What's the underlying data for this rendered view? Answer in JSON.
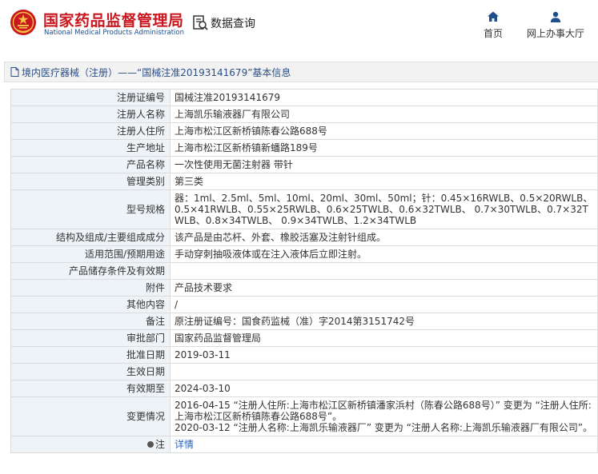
{
  "header": {
    "brand_cn": "国家药品监督管理局",
    "brand_en": "National Medical Products Administration",
    "query_label": "数据查询",
    "nav_home": "首页",
    "nav_office": "网上办事大厅",
    "colors": {
      "brand_red": "#c8171e",
      "nav_blue": "#1f4e8c"
    }
  },
  "breadcrumb": "境内医疗器械（注册）——“国械注准20193141679”基本信息",
  "rows": [
    {
      "label": "注册证编号",
      "value": "国械注准20193141679"
    },
    {
      "label": "注册人名称",
      "value": "上海凯乐输液器厂有限公司"
    },
    {
      "label": "注册人住所",
      "value": "上海市松江区新桥镇陈春公路688号"
    },
    {
      "label": "生产地址",
      "value": "上海市松江区新桥镇新蟠路189号"
    },
    {
      "label": "产品名称",
      "value": "一次性使用无菌注射器 带针"
    },
    {
      "label": "管理类别",
      "value": "第三类"
    },
    {
      "label": "型号规格",
      "value": "器：1ml、2.5ml、5ml、10ml、20ml、30ml、50ml；针：0.45×16RWLB、0.5×20RWLB、0.5×41RWLB、0.55×25RWLB、0.6×25TWLB、0.6×32TWLB、 0.7×30TWLB、0.7×32TWLB、0.8×34TWLB、 0.9×34TWLB、1.2×34TWLB"
    },
    {
      "label": "结构及组成/主要组成成分",
      "value": "该产品是由芯杆、外套、橡胶活塞及注射针组成。"
    },
    {
      "label": "适用范围/预期用途",
      "value": "手动穿刺抽吸液体或在注入液体后立即注射。"
    },
    {
      "label": "产品储存条件及有效期",
      "value": ""
    },
    {
      "label": "附件",
      "value": "产品技术要求"
    },
    {
      "label": "其他内容",
      "value": "/"
    },
    {
      "label": "备注",
      "value": "原注册证编号：国食药监械（准）字2014第3151742号"
    },
    {
      "label": "审批部门",
      "value": "国家药品监督管理局"
    },
    {
      "label": "批准日期",
      "value": "2019-03-11"
    },
    {
      "label": "生效日期",
      "value": ""
    },
    {
      "label": "有效期至",
      "value": "2024-03-10"
    },
    {
      "label": "变更情况",
      "value": "2016-04-15 “注册人住所:上海市松江区新桥镇潘家浜村（陈春公路688号）” 变更为 “注册人住所:上海市松江区新桥镇陈春公路688号”。\n2020-03-12 “注册人名称:上海凯乐输液器厂” 变更为 “注册人名称:上海凯乐输液器厂有限公司”。"
    },
    {
      "label": "注",
      "value": "详情"
    }
  ]
}
